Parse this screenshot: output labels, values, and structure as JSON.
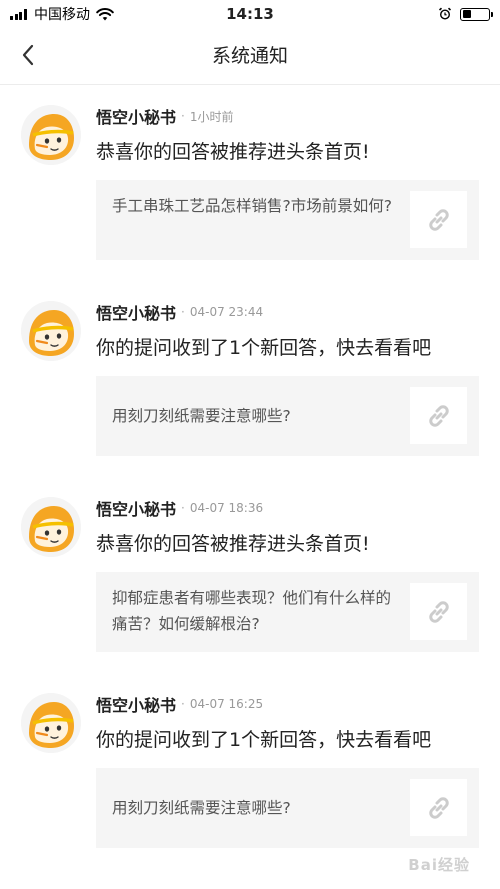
{
  "status_bar": {
    "carrier": "中国移动",
    "time": "14:13",
    "signal_bars": 4,
    "battery_level": 0.35
  },
  "nav": {
    "title": "系统通知",
    "back_icon": "chevron-left-icon"
  },
  "notifications": [
    {
      "sender": "悟空小秘书",
      "time": "1小时前",
      "message": "恭喜你的回答被推荐进头条首页!",
      "quote": "手工串珠工艺品怎样销售?市场前景如何?"
    },
    {
      "sender": "悟空小秘书",
      "time": "04-07 23:44",
      "message": "你的提问收到了1个新回答，快去看看吧",
      "quote": "用刻刀刻纸需要注意哪些?"
    },
    {
      "sender": "悟空小秘书",
      "time": "04-07 18:36",
      "message": "恭喜你的回答被推荐进头条首页!",
      "quote": "抑郁症患者有哪些表现？他们有什么样的痛苦？如何缓解根治?"
    },
    {
      "sender": "悟空小秘书",
      "time": "04-07 16:25",
      "message": "你的提问收到了1个新回答，快去看看吧",
      "quote": "用刻刀刻纸需要注意哪些?"
    }
  ],
  "colors": {
    "avatar_orange": "#f5a623",
    "card_background": "#f5f5f5",
    "link_icon": "#cccccc"
  },
  "watermark": "Bai经验"
}
